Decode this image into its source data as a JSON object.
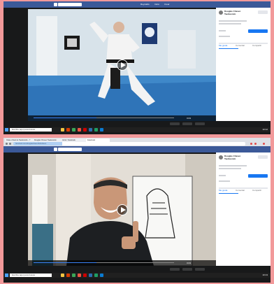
{
  "facebook": {
    "search_placeholder": "Buscar",
    "nav": [
      "Reynaldo",
      "Inicio",
      "Crear"
    ],
    "page_name": "Douglas Chavez Taekwondo",
    "follow_label": "Seguir",
    "share_label": "Compartir publicación",
    "tabs": [
      "Me gusta",
      "Comentar",
      "Compartir"
    ]
  },
  "video1": {
    "time": "0:03",
    "progress": 0.45
  },
  "video2": {
    "time": "0:03",
    "progress": 0.45
  },
  "taskbar": {
    "search_placeholder": "Escribe aquí para buscar",
    "clock1": "10:12",
    "clock2": "10:13"
  },
  "browser": {
    "tabs": [
      "Clase virtual de Taekwondo - Y",
      "Douglas Chavez Taekwondo",
      "Inicio / Facebook",
      "Facebook"
    ],
    "url": "facebook.com/douglaschaveztkd/videos"
  },
  "colors": {
    "fb_blue": "#3b5998",
    "link_blue": "#1877f2",
    "frame_bg": "#f2999a"
  }
}
